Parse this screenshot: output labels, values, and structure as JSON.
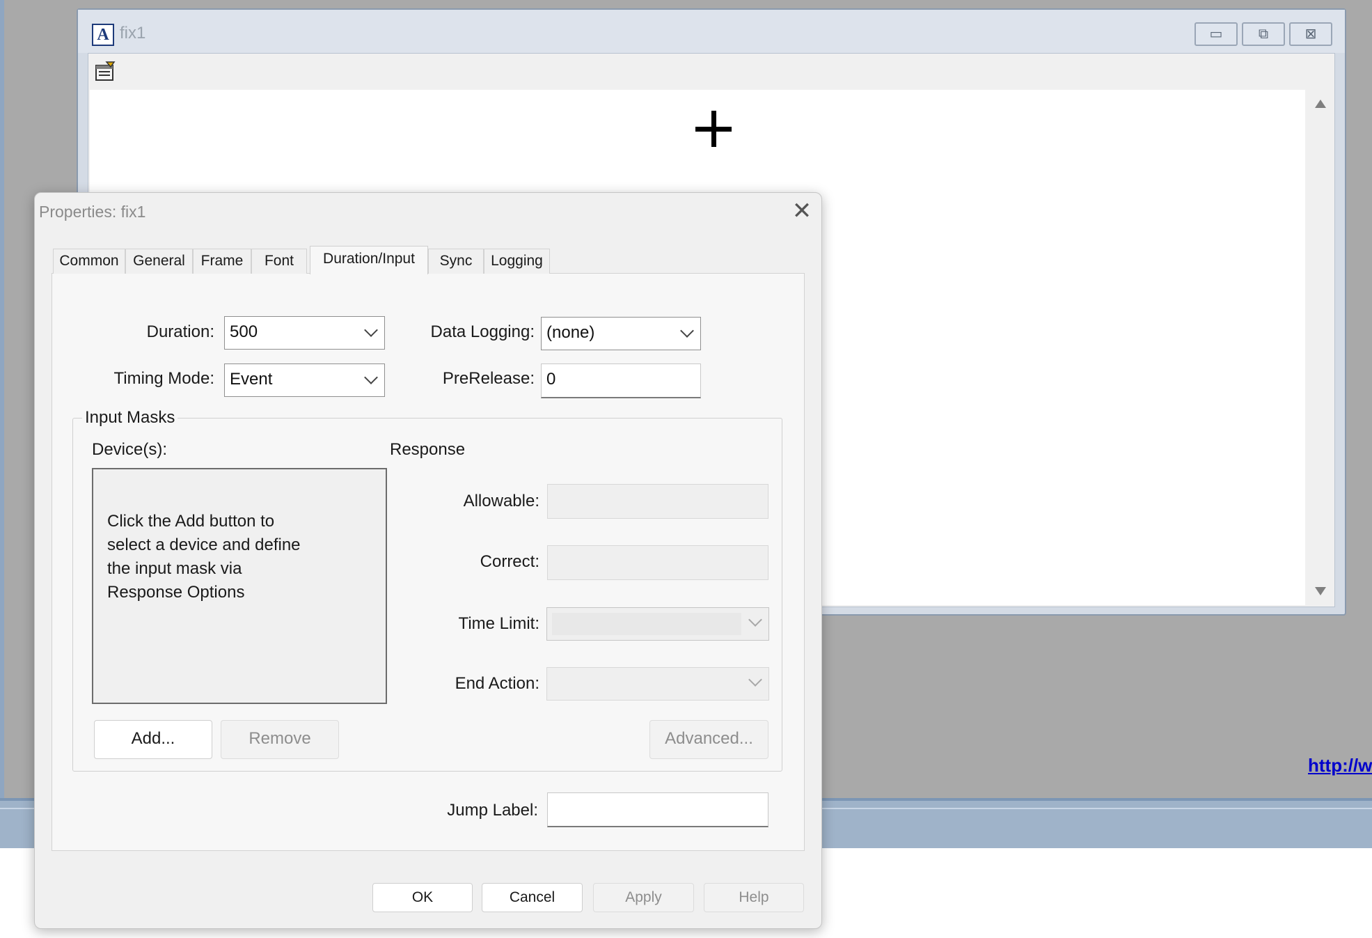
{
  "background": {
    "link_text": "http://w"
  },
  "window": {
    "title": "fix1",
    "app_icon_letter": "A",
    "controls": {
      "minimize": "▭",
      "restore": "⧉",
      "close": "⊠"
    }
  },
  "dialog": {
    "title": "Properties: fix1",
    "close_glyph": "✕",
    "tabs": [
      "Common",
      "General",
      "Frame",
      "Font",
      "Duration/Input",
      "Sync",
      "Logging"
    ],
    "active_tab": "Duration/Input",
    "fields": {
      "duration_label": "Duration:",
      "duration_value": "500",
      "timing_mode_label": "Timing Mode:",
      "timing_mode_value": "Event",
      "data_logging_label": "Data Logging:",
      "data_logging_value": "(none)",
      "prerelease_label": "PreRelease:",
      "prerelease_value": "0"
    },
    "input_masks": {
      "legend": "Input Masks",
      "devices_label": "Device(s):",
      "devices_hint": "Click the Add button to\nselect a device and define\nthe input mask via\nResponse Options",
      "response_label": "Response",
      "allowable_label": "Allowable:",
      "correct_label": "Correct:",
      "time_limit_label": "Time Limit:",
      "end_action_label": "End Action:",
      "add_button": "Add...",
      "remove_button": "Remove",
      "advanced_button": "Advanced..."
    },
    "jump_label": "Jump Label:",
    "footer": {
      "ok": "OK",
      "cancel": "Cancel",
      "apply": "Apply",
      "help": "Help"
    }
  }
}
